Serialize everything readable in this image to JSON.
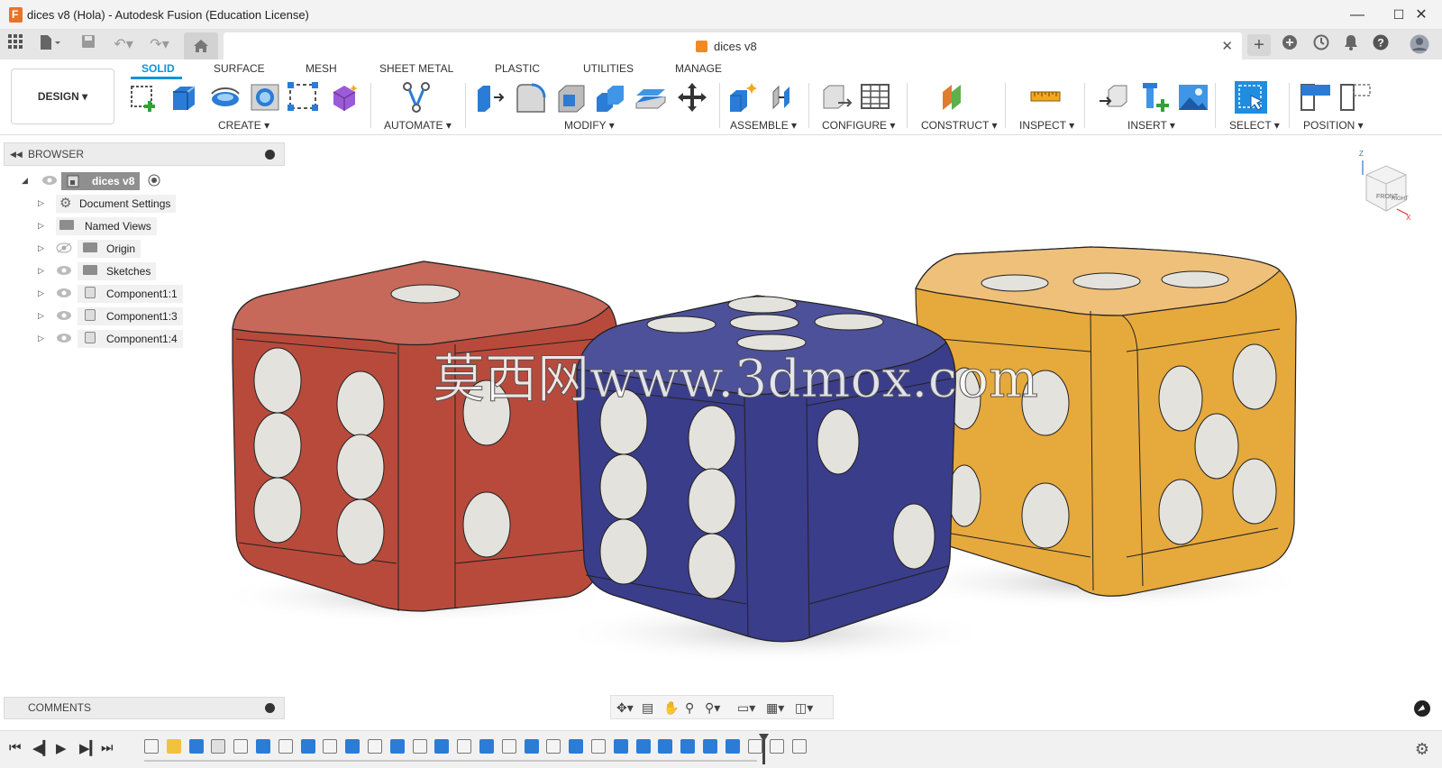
{
  "window": {
    "title": "dices v8 (Hola) - Autodesk Fusion (Education License)",
    "minimize": "—",
    "maximize": "☐",
    "close": "✕"
  },
  "tab": {
    "name": "dices v8",
    "close": "✕"
  },
  "workspace": {
    "label": "DESIGN ▾"
  },
  "ws_tabs": [
    "SOLID",
    "SURFACE",
    "MESH",
    "SHEET METAL",
    "PLASTIC",
    "UTILITIES",
    "MANAGE"
  ],
  "groups": {
    "create": "CREATE ▾",
    "automate": "AUTOMATE ▾",
    "modify": "MODIFY ▾",
    "assemble": "ASSEMBLE ▾",
    "configure": "CONFIGURE ▾",
    "construct": "CONSTRUCT ▾",
    "inspect": "INSPECT ▾",
    "insert": "INSERT ▾",
    "select": "SELECT ▾",
    "position": "POSITION ▾"
  },
  "browser": {
    "title": "BROWSER",
    "root": "dices v8",
    "items": [
      "Document Settings",
      "Named Views",
      "Origin",
      "Sketches",
      "Component1:1",
      "Component1:3",
      "Component1:4"
    ]
  },
  "comments": {
    "title": "COMMENTS"
  },
  "viewcube": {
    "front": "FRONT",
    "right": "RIGHT",
    "z": "Z",
    "x": "X"
  },
  "watermark": "莫西网www.3dmox.com",
  "colors": {
    "accent": "#0696d7",
    "die_red": "#b84a3c",
    "die_blue": "#3a3d8a",
    "die_yellow": "#e6a93c",
    "pip": "#e4e2dc"
  }
}
